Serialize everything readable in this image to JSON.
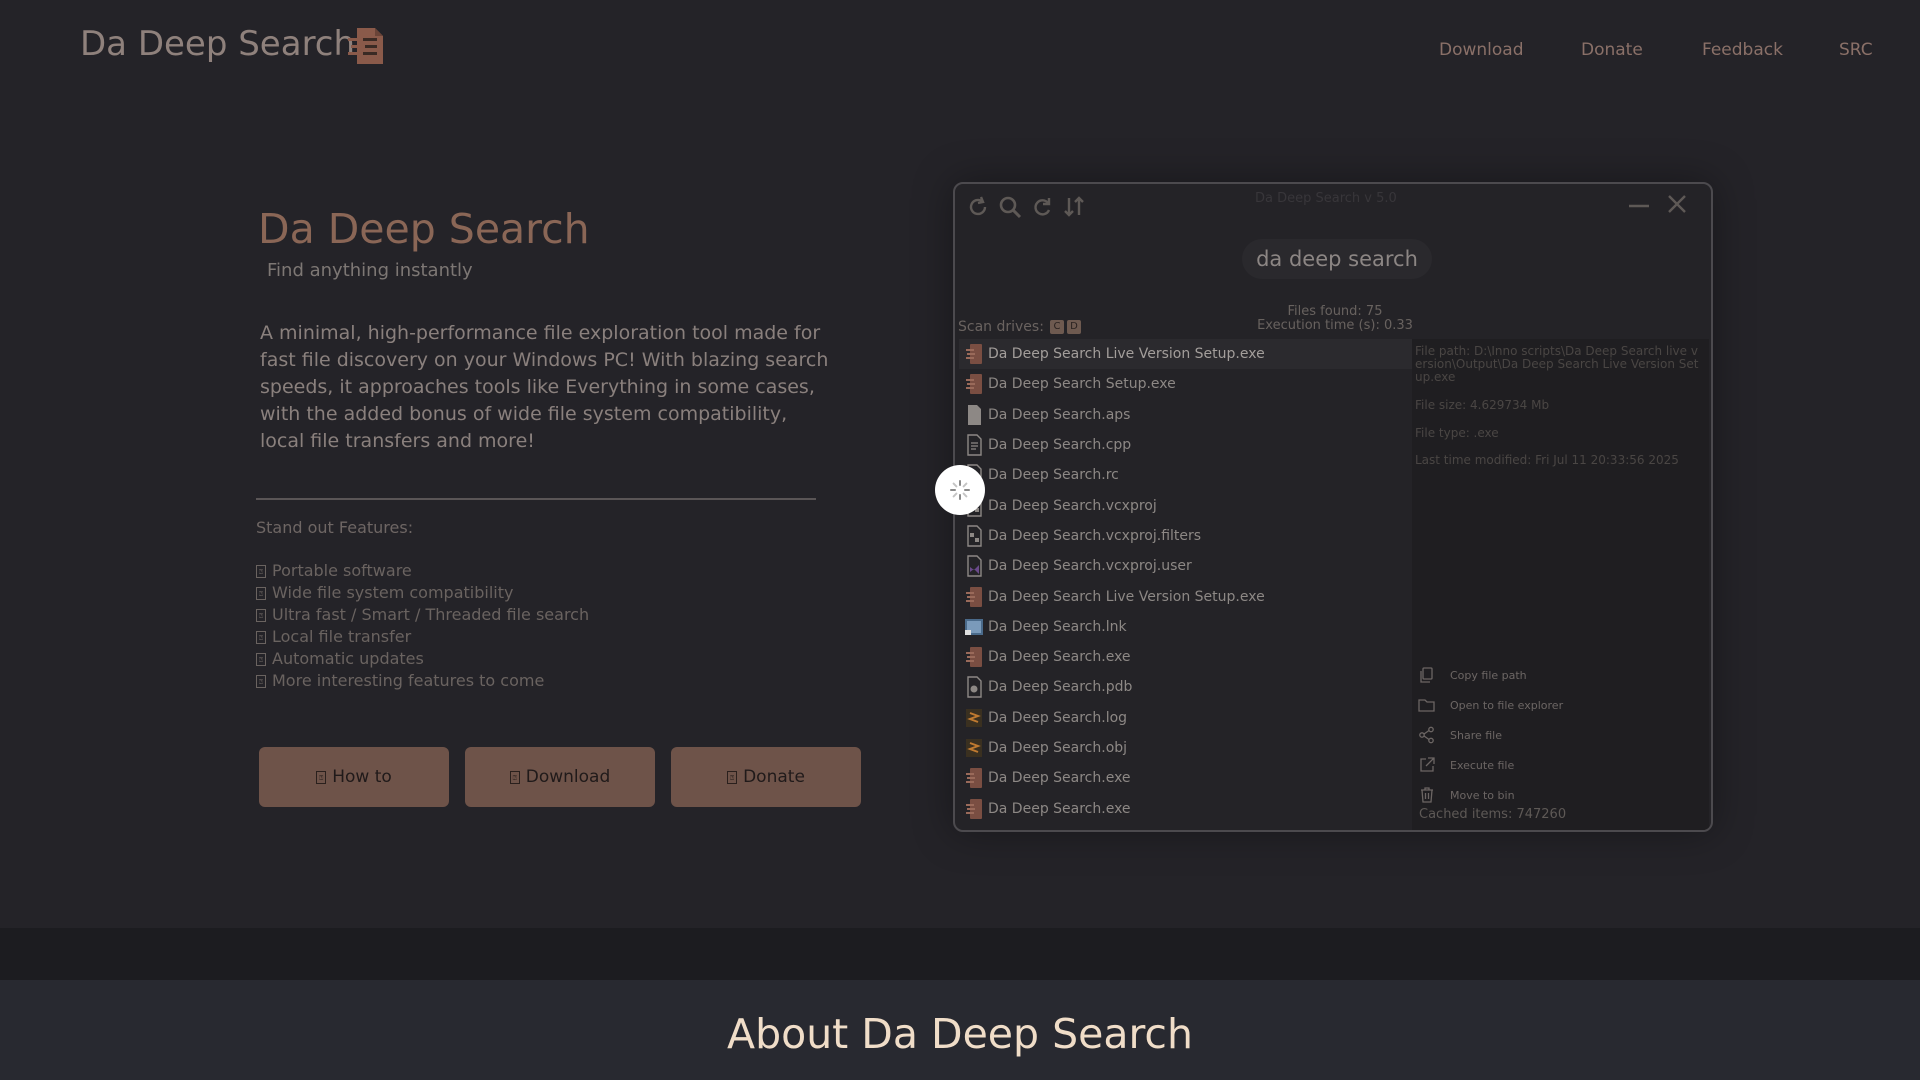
{
  "header": {
    "brand": "Da Deep Search",
    "nav": [
      "Download",
      "Donate",
      "Feedback",
      "SRC"
    ]
  },
  "hero": {
    "title": "Da Deep Search",
    "subtitle": "Find anything instantly",
    "description": "A minimal, high-performance file exploration tool made for fast file discovery on your Windows PC! With blazing search speeds, it approaches tools like Everything in some cases, with the added bonus of wide file system compatibility, local file transfers and more!",
    "features_title": "Stand out Features:",
    "features": [
      "Portable software",
      "Wide file system compatibility",
      "Ultra fast / Smart / Threaded file search",
      "Local file transfer",
      "Automatic updates",
      "More interesting features to come"
    ],
    "buttons": {
      "howto": "How to",
      "download": "Download",
      "donate": "Donate"
    }
  },
  "app": {
    "title": "Da Deep Search v 5.0",
    "search_value": "da deep search",
    "files_found": "Files found: 75",
    "execution_time": "Execution time (s): 0.33",
    "scan_label": "Scan drives:",
    "drives": [
      "C",
      "D"
    ],
    "files": [
      {
        "name": "Da Deep Search Live Version Setup.exe",
        "icon": "app-icon",
        "selected": true
      },
      {
        "name": "Da Deep Search Setup.exe",
        "icon": "app-icon"
      },
      {
        "name": "Da Deep Search.aps",
        "icon": "file-icon"
      },
      {
        "name": "Da Deep Search.cpp",
        "icon": "code-file-icon"
      },
      {
        "name": "Da Deep Search.rc",
        "icon": "resource-file-icon"
      },
      {
        "name": "Da Deep Search.vcxproj",
        "icon": "project-file-icon"
      },
      {
        "name": "Da Deep Search.vcxproj.filters",
        "icon": "project-file-icon"
      },
      {
        "name": "Da Deep Search.vcxproj.user",
        "icon": "vs-file-icon"
      },
      {
        "name": "Da Deep Search Live Version Setup.exe",
        "icon": "app-icon"
      },
      {
        "name": "Da Deep Search.lnk",
        "icon": "shortcut-icon"
      },
      {
        "name": "Da Deep Search.exe",
        "icon": "app-icon"
      },
      {
        "name": "Da Deep Search.pdb",
        "icon": "debug-file-icon"
      },
      {
        "name": "Da Deep Search.log",
        "icon": "log-file-icon"
      },
      {
        "name": "Da Deep Search.obj",
        "icon": "log-file-icon"
      },
      {
        "name": "Da Deep Search.exe",
        "icon": "app-icon"
      },
      {
        "name": "Da Deep Search.exe",
        "icon": "app-icon"
      }
    ],
    "details": {
      "path": "File path: D:\\Inno scripts\\Da Deep Search live version\\Output\\Da Deep Search Live Version Setup.exe",
      "size": "File size: 4.629734 Mb",
      "type": "File type: .exe",
      "modified": "Last time modified: Fri Jul 11 20:33:56 2025"
    },
    "actions": [
      "Copy file path",
      "Open to file explorer",
      "Share file",
      "Execute file",
      "Move to bin"
    ],
    "cached": "Cached items: 747260"
  },
  "about": {
    "title": "About Da Deep Search"
  },
  "colors": {
    "accent": "#6e5349",
    "background": "#242328",
    "title": "#8a6656"
  }
}
